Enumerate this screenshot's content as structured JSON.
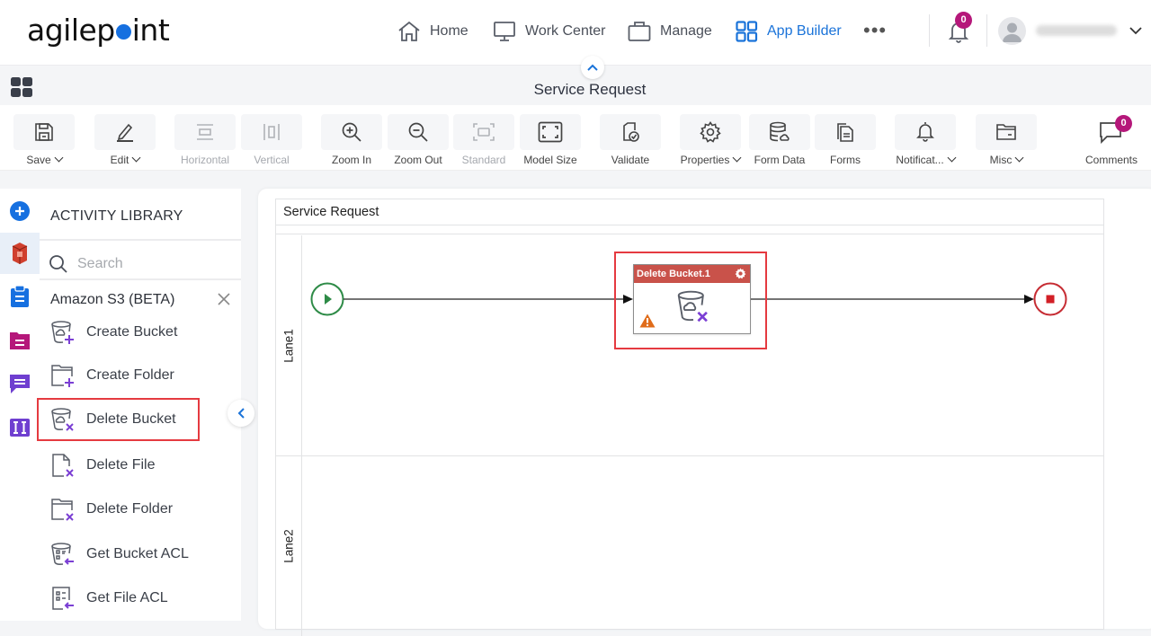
{
  "brand": {
    "logo_pre": "agilep",
    "logo_post": "int",
    "accent": "#1670e0"
  },
  "nav": {
    "items": [
      {
        "label": "Home",
        "icon": "home-icon"
      },
      {
        "label": "Work Center",
        "icon": "monitor-icon"
      },
      {
        "label": "Manage",
        "icon": "briefcase-icon"
      },
      {
        "label": "App Builder",
        "icon": "grid-icon",
        "active": true
      }
    ],
    "more_label": "•••",
    "notification_count": "0",
    "user_name": "(blurred)"
  },
  "titlebar": {
    "title": "Service Request"
  },
  "toolbar": {
    "items": [
      {
        "label": "Save",
        "icon": "save-icon",
        "dropdown": true,
        "enabled": true
      },
      {
        "label": "Edit",
        "icon": "pencil-icon",
        "dropdown": true,
        "enabled": true
      },
      {
        "label": "Horizontal",
        "icon": "horizontal-icon",
        "enabled": false
      },
      {
        "label": "Vertical",
        "icon": "vertical-icon",
        "enabled": false
      },
      {
        "label": "Zoom In",
        "icon": "zoom-in-icon",
        "enabled": true
      },
      {
        "label": "Zoom Out",
        "icon": "zoom-out-icon",
        "enabled": true
      },
      {
        "label": "Standard",
        "icon": "standard-icon",
        "enabled": false
      },
      {
        "label": "Model Size",
        "icon": "fit-icon",
        "enabled": true
      },
      {
        "label": "Validate",
        "icon": "validate-icon",
        "enabled": true
      },
      {
        "label": "Properties",
        "icon": "gear-icon",
        "dropdown": true,
        "enabled": true
      },
      {
        "label": "Form Data",
        "icon": "database-icon",
        "enabled": true
      },
      {
        "label": "Forms",
        "icon": "forms-icon",
        "enabled": true
      },
      {
        "label": "Notificat...",
        "icon": "bell-icon",
        "dropdown": true,
        "enabled": true
      },
      {
        "label": "Misc",
        "icon": "folder-icon",
        "dropdown": true,
        "enabled": true
      }
    ],
    "comments_label": "Comments",
    "comments_count": "0"
  },
  "rail": {
    "items": [
      "add-icon",
      "amazon-s3-icon",
      "clipboard-icon",
      "folder-doc-icon",
      "chat-icon",
      "text-field-icon"
    ],
    "colors": {
      "add": "#1670e0",
      "s3": "#d0402e",
      "clipboard": "#1670e0",
      "folder": "#b5177a",
      "chat": "#6f3fd0",
      "text": "#6f3fd0"
    }
  },
  "library": {
    "title": "ACTIVITY LIBRARY",
    "search_placeholder": "Search",
    "category": "Amazon S3 (BETA)",
    "items": [
      {
        "label": "Create Bucket",
        "icon": "bucket-add-icon"
      },
      {
        "label": "Create Folder",
        "icon": "folder-add-icon"
      },
      {
        "label": "Delete Bucket",
        "icon": "bucket-delete-icon",
        "highlighted": true
      },
      {
        "label": "Delete File",
        "icon": "file-delete-icon"
      },
      {
        "label": "Delete Folder",
        "icon": "folder-delete-icon"
      },
      {
        "label": "Get Bucket ACL",
        "icon": "bucket-acl-icon"
      },
      {
        "label": "Get File ACL",
        "icon": "file-acl-icon"
      }
    ]
  },
  "canvas": {
    "pool_title": "Service Request",
    "lanes": [
      "Lane1",
      "Lane2"
    ],
    "activity": {
      "title": "Delete Bucket.1",
      "header_color": "#c9524a",
      "warning": true
    },
    "start_color": "#2e8b47",
    "end_color": "#c62c33"
  }
}
